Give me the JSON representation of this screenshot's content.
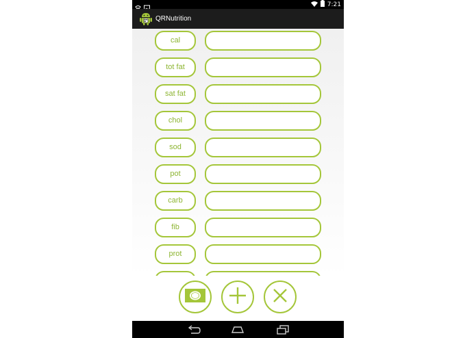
{
  "status_bar": {
    "time": "7:21"
  },
  "action_bar": {
    "title": "QRNutrition",
    "icon": "android-robot-icon"
  },
  "fields": [
    {
      "label": "cal",
      "value": ""
    },
    {
      "label": "tot fat",
      "value": ""
    },
    {
      "label": "sat fat",
      "value": ""
    },
    {
      "label": "chol",
      "value": ""
    },
    {
      "label": "sod",
      "value": ""
    },
    {
      "label": "pot",
      "value": ""
    },
    {
      "label": "carb",
      "value": ""
    },
    {
      "label": "fib",
      "value": ""
    },
    {
      "label": "prot",
      "value": ""
    },
    {
      "label": "",
      "value": ""
    }
  ],
  "bottom_buttons": [
    {
      "name": "camera-button",
      "icon": "camera-icon"
    },
    {
      "name": "add-button",
      "icon": "plus-icon"
    },
    {
      "name": "clear-button",
      "icon": "close-icon"
    }
  ],
  "nav_bar": {
    "icons": [
      "back-icon",
      "home-icon",
      "recent-apps-icon"
    ]
  },
  "colors": {
    "accent": "#a4c639",
    "label_text": "#8db532",
    "action_bar_bg": "#1c1c1c",
    "status_bar_bg": "#000000"
  }
}
